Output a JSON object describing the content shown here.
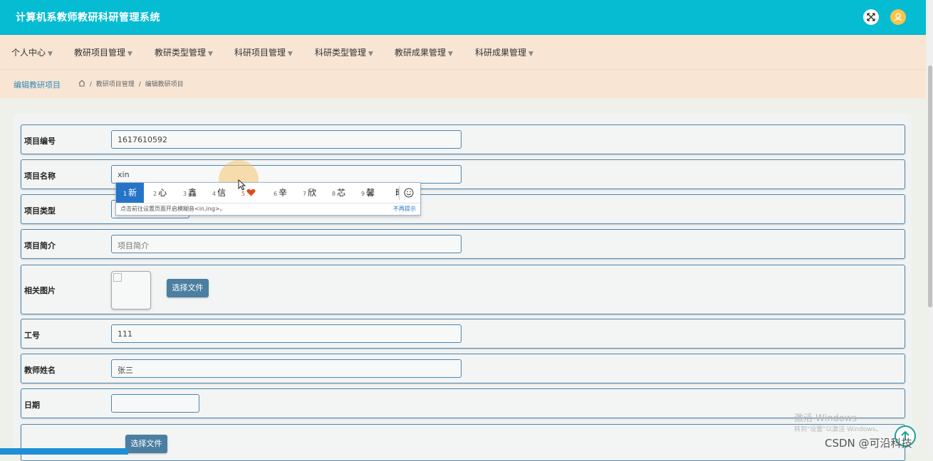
{
  "header": {
    "app_title": "计算机系教师教研科研管理系统",
    "expand_icon": "expand-icon",
    "avatar_icon": "user-avatar-icon"
  },
  "menu": {
    "items": [
      {
        "label": "个人中心"
      },
      {
        "label": "教研项目管理"
      },
      {
        "label": "教研类型管理"
      },
      {
        "label": "科研项目管理"
      },
      {
        "label": "科研类型管理"
      },
      {
        "label": "教研成果管理"
      },
      {
        "label": "科研成果管理"
      }
    ]
  },
  "breadcrumb": {
    "page_title": "编辑教研项目",
    "path_1": "教研项目管理",
    "path_2": "编辑教研项目",
    "separator": "/"
  },
  "form": {
    "project_no": {
      "label": "项目编号",
      "value": "1617610592"
    },
    "project_name": {
      "label": "项目名称",
      "value": "xin"
    },
    "project_type": {
      "label": "项目类型",
      "value": ""
    },
    "project_intro": {
      "label": "项目简介",
      "placeholder": "项目简介"
    },
    "related_image": {
      "label": "相关图片",
      "button": "选择文件"
    },
    "staff_no": {
      "label": "工号",
      "value": "111"
    },
    "teacher_name": {
      "label": "教师姓名",
      "value": "张三"
    },
    "date": {
      "label": "日期",
      "value": ""
    },
    "file_button": "选择文件"
  },
  "ime": {
    "candidates": [
      {
        "num": "1",
        "text": "新"
      },
      {
        "num": "2",
        "text": "心"
      },
      {
        "num": "3",
        "text": "鑫"
      },
      {
        "num": "4",
        "text": "信"
      },
      {
        "num": "5",
        "text": "heart-emoji"
      },
      {
        "num": "6",
        "text": "辛"
      },
      {
        "num": "7",
        "text": "欣"
      },
      {
        "num": "8",
        "text": "芯"
      },
      {
        "num": "9",
        "text": "馨"
      },
      {
        "num": "",
        "text": "昕"
      }
    ],
    "hint": "点击前往设置页面开启模糊音<in,ing>。",
    "dismiss": "不再提示"
  },
  "watermark": {
    "line1": "激活 Windows",
    "line2": "转到\"设置\"以激活 Windows。"
  },
  "footer_credit": "CSDN @可沿科技",
  "colors": {
    "header": "#06bcd3",
    "menu_bg": "#f8e5d3",
    "field_border": "#4d86ad",
    "button": "#4b7fa1",
    "ime_active": "#2574c8"
  }
}
